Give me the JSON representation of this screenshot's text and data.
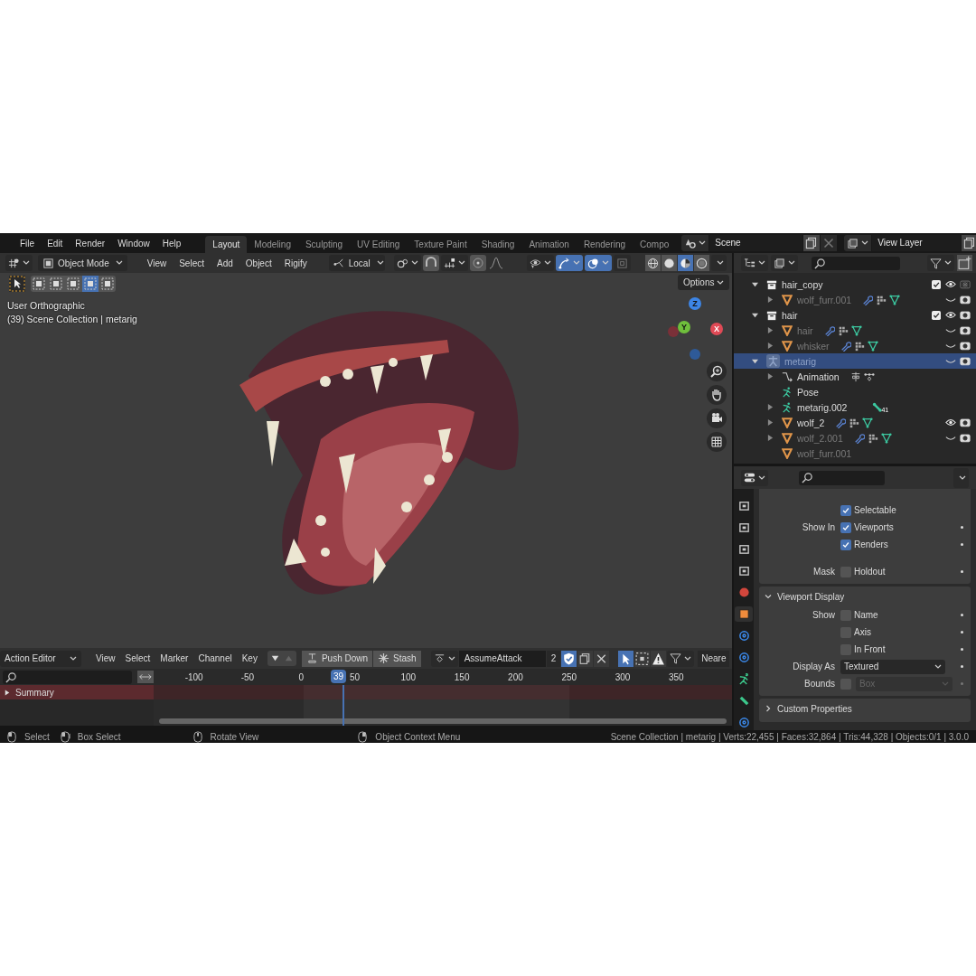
{
  "menu": [
    "File",
    "Edit",
    "Render",
    "Window",
    "Help"
  ],
  "workspaces": [
    {
      "label": "Layout",
      "selected": true
    },
    {
      "label": "Modeling",
      "selected": false
    },
    {
      "label": "Sculpting",
      "selected": false
    },
    {
      "label": "UV Editing",
      "selected": false
    },
    {
      "label": "Texture Paint",
      "selected": false
    },
    {
      "label": "Shading",
      "selected": false
    },
    {
      "label": "Animation",
      "selected": false
    },
    {
      "label": "Rendering",
      "selected": false
    },
    {
      "label": "Compo",
      "selected": false
    }
  ],
  "scene": "Scene",
  "view_layer": "View Layer",
  "viewport": {
    "mode": "Object Mode",
    "menus": [
      "View",
      "Select",
      "Add",
      "Object",
      "Rigify"
    ],
    "pivot": "Local",
    "select_modes": [
      {
        "selected": false
      },
      {
        "selected": false
      },
      {
        "selected": false
      },
      {
        "selected": true
      },
      {
        "selected": false
      }
    ],
    "toggles": [
      {
        "kind": "gizmo",
        "on": true
      },
      {
        "kind": "overlay",
        "on": true
      },
      {
        "kind": "xray",
        "on": false
      }
    ],
    "shading": [
      {
        "kind": "wireframe",
        "selected": false
      },
      {
        "kind": "solid",
        "selected": false
      },
      {
        "kind": "material",
        "selected": true
      },
      {
        "kind": "rendered",
        "selected": false
      }
    ],
    "options": "Options",
    "overlay_lines": [
      "User Orthographic",
      "(39) Scene Collection | metarig"
    ],
    "axes": [
      "Z",
      "Y",
      "X"
    ]
  },
  "outliner": {
    "items": [
      {
        "name": "hair_copy",
        "kind": "collection",
        "expanded": true,
        "selected": false,
        "dimmed": false,
        "checked": true,
        "visible": true,
        "renderable": false,
        "children": [
          {
            "name": "wolf_furr.001",
            "kind": "mesh",
            "expanded": false,
            "selected": false,
            "dimmed": true,
            "has_modifiers": true,
            "visible": false,
            "renderable": true
          }
        ]
      },
      {
        "name": "hair",
        "kind": "collection",
        "expanded": true,
        "selected": false,
        "dimmed": false,
        "checked": true,
        "visible": true,
        "renderable": true,
        "children": [
          {
            "name": "hair",
            "kind": "mesh",
            "expanded": false,
            "selected": false,
            "dimmed": true,
            "has_modifiers": true,
            "visible": false,
            "renderable": true
          },
          {
            "name": "whisker",
            "kind": "mesh",
            "expanded": false,
            "selected": false,
            "dimmed": true,
            "has_modifiers": true,
            "visible": false,
            "renderable": true
          }
        ]
      },
      {
        "name": "metarig",
        "kind": "armature",
        "expanded": true,
        "selected": true,
        "dimmed": true,
        "visible": false,
        "renderable": true,
        "children": [
          {
            "name": "Animation",
            "kind": "animation",
            "expanded": false,
            "selected": false,
            "dimmed": false
          },
          {
            "name": "Pose",
            "kind": "pose",
            "selected": false,
            "dimmed": false
          },
          {
            "name": "metarig.002",
            "kind": "armature_data",
            "expanded": false,
            "selected": false,
            "dimmed": false,
            "badge": "41"
          },
          {
            "name": "wolf_2",
            "kind": "mesh",
            "expanded": false,
            "selected": false,
            "dimmed": false,
            "has_modifiers": true,
            "visible": true,
            "renderable": true
          },
          {
            "name": "wolf_2.001",
            "kind": "mesh",
            "expanded": false,
            "selected": false,
            "dimmed": true,
            "has_modifiers": true,
            "visible": false,
            "renderable": true
          },
          {
            "name": "wolf_furr.001",
            "kind": "mesh",
            "selected": false,
            "dimmed": true,
            "has_modifiers": false
          }
        ]
      }
    ]
  },
  "properties": {
    "tabs": [
      {
        "kind": "render",
        "selected": false
      },
      {
        "kind": "output",
        "selected": false
      },
      {
        "kind": "view_layer",
        "selected": false
      },
      {
        "kind": "scene",
        "selected": false
      },
      {
        "kind": "world",
        "selected": false
      },
      {
        "kind": "object",
        "selected": true
      },
      {
        "kind": "physics",
        "selected": false
      },
      {
        "kind": "constraints",
        "selected": false
      },
      {
        "kind": "armature",
        "selected": false
      },
      {
        "kind": "bone",
        "selected": false
      },
      {
        "kind": "bone_constraints",
        "selected": false
      }
    ],
    "panels": [
      {
        "rows": [
          {
            "kind": "checkbox",
            "text": "Selectable",
            "checked": true,
            "decorator": false
          },
          {
            "kind": "checkbox",
            "label": "Show In",
            "text": "Viewports",
            "checked": true,
            "decorator": true
          },
          {
            "kind": "checkbox",
            "text": "Renders",
            "checked": true,
            "decorator": true
          },
          {
            "kind": "separator"
          },
          {
            "kind": "checkbox",
            "label": "Mask",
            "text": "Holdout",
            "checked": false,
            "decorator": true
          }
        ]
      },
      {
        "title": "Viewport Display",
        "expanded": true,
        "rows": [
          {
            "kind": "checkbox",
            "label": "Show",
            "text": "Name",
            "checked": false,
            "decorator": true
          },
          {
            "kind": "checkbox",
            "text": "Axis",
            "checked": false,
            "decorator": true
          },
          {
            "kind": "checkbox",
            "text": "In Front",
            "checked": false,
            "decorator": true
          },
          {
            "kind": "dropdown",
            "label": "Display As",
            "value": "Textured",
            "decorator": true
          },
          {
            "kind": "checkbox_dropdown",
            "label": "Bounds",
            "checked": false,
            "value": "Box",
            "disabled": true,
            "decorator": true
          }
        ]
      },
      {
        "title": "Custom Properties",
        "expanded": false
      }
    ]
  },
  "action_editor": {
    "mode": "Action Editor",
    "menus": [
      "View",
      "Select",
      "Marker",
      "Channel",
      "Key"
    ],
    "push_down": "Push Down",
    "stash": "Stash",
    "action": "AssumeAttack",
    "users": "2",
    "snap": "Neare",
    "ticks": [
      "-100",
      "-50",
      "0",
      "50",
      "100",
      "150",
      "200",
      "250",
      "300",
      "350"
    ],
    "current_frame": "39",
    "channels": [
      {
        "name": "Summary",
        "expanded": false
      }
    ]
  },
  "status_bar": {
    "hints": [
      {
        "kind": "lmb",
        "text": "Select"
      },
      {
        "kind": "drag",
        "text": "Box Select"
      },
      {
        "kind": "mmb",
        "text": "Rotate View"
      },
      {
        "kind": "rmb",
        "text": "Object Context Menu"
      }
    ],
    "stats": "Scene Collection | metarig | Verts:22,455 | Faces:32,864 | Tris:44,328 | Objects:0/1 | 3.0.0"
  }
}
